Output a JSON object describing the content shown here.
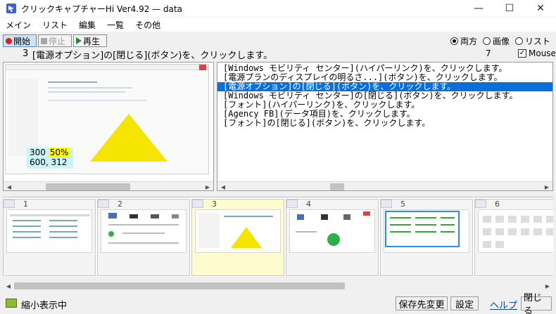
{
  "window": {
    "title": "クリックキャプチャーHi Ver4.92  —  data",
    "minimize": "—",
    "maximize": "☐",
    "close": "✕"
  },
  "menu": [
    "メイン",
    "リスト",
    "編集",
    "一覧",
    "その他"
  ],
  "toolbar": {
    "record_label": "開始",
    "stop_label": "停止",
    "play_label": "再生",
    "view_options": [
      "両方",
      "画像",
      "リスト"
    ],
    "view_selected": "両方"
  },
  "status": {
    "step_number": "3",
    "step_text": "[電源オプション]の[閉じる](ボタン)を、クリックします。",
    "count": "7",
    "mouse_label": "Mouse",
    "mouse_checked": true
  },
  "preview": {
    "zoom": "300",
    "zoom_pct": "50%",
    "coords": "600, 312",
    "triangle_color": "#f5e400"
  },
  "list": [
    "[Windows モビリティ センター](ハイパーリンク)を、クリックします。",
    "[電源プランのディスプレイの明るさ...](ボタン)を、クリックします。",
    "[電源オプション]の[閉じる](ボタン)を、クリックします。",
    "[Windows モビリティ センター]の[閉じる](ボタン)を、クリックします。",
    "[フォント](ハイパーリンク)を、クリックします。",
    "[Agency FB](データ項目)を、クリックします。",
    "[フォント]の[閉じる](ボタン)を、クリックします。"
  ],
  "selected_index": 2,
  "thumbnails": [
    {
      "num": "1"
    },
    {
      "num": "2"
    },
    {
      "num": "3"
    },
    {
      "num": "4"
    },
    {
      "num": "5"
    },
    {
      "num": "6"
    }
  ],
  "bottom": {
    "status_text": "縮小表示中",
    "save_dest_label": "保存先変更",
    "settings_label": "設定",
    "help_label": "ヘルプ",
    "close_label": "閉じる"
  }
}
